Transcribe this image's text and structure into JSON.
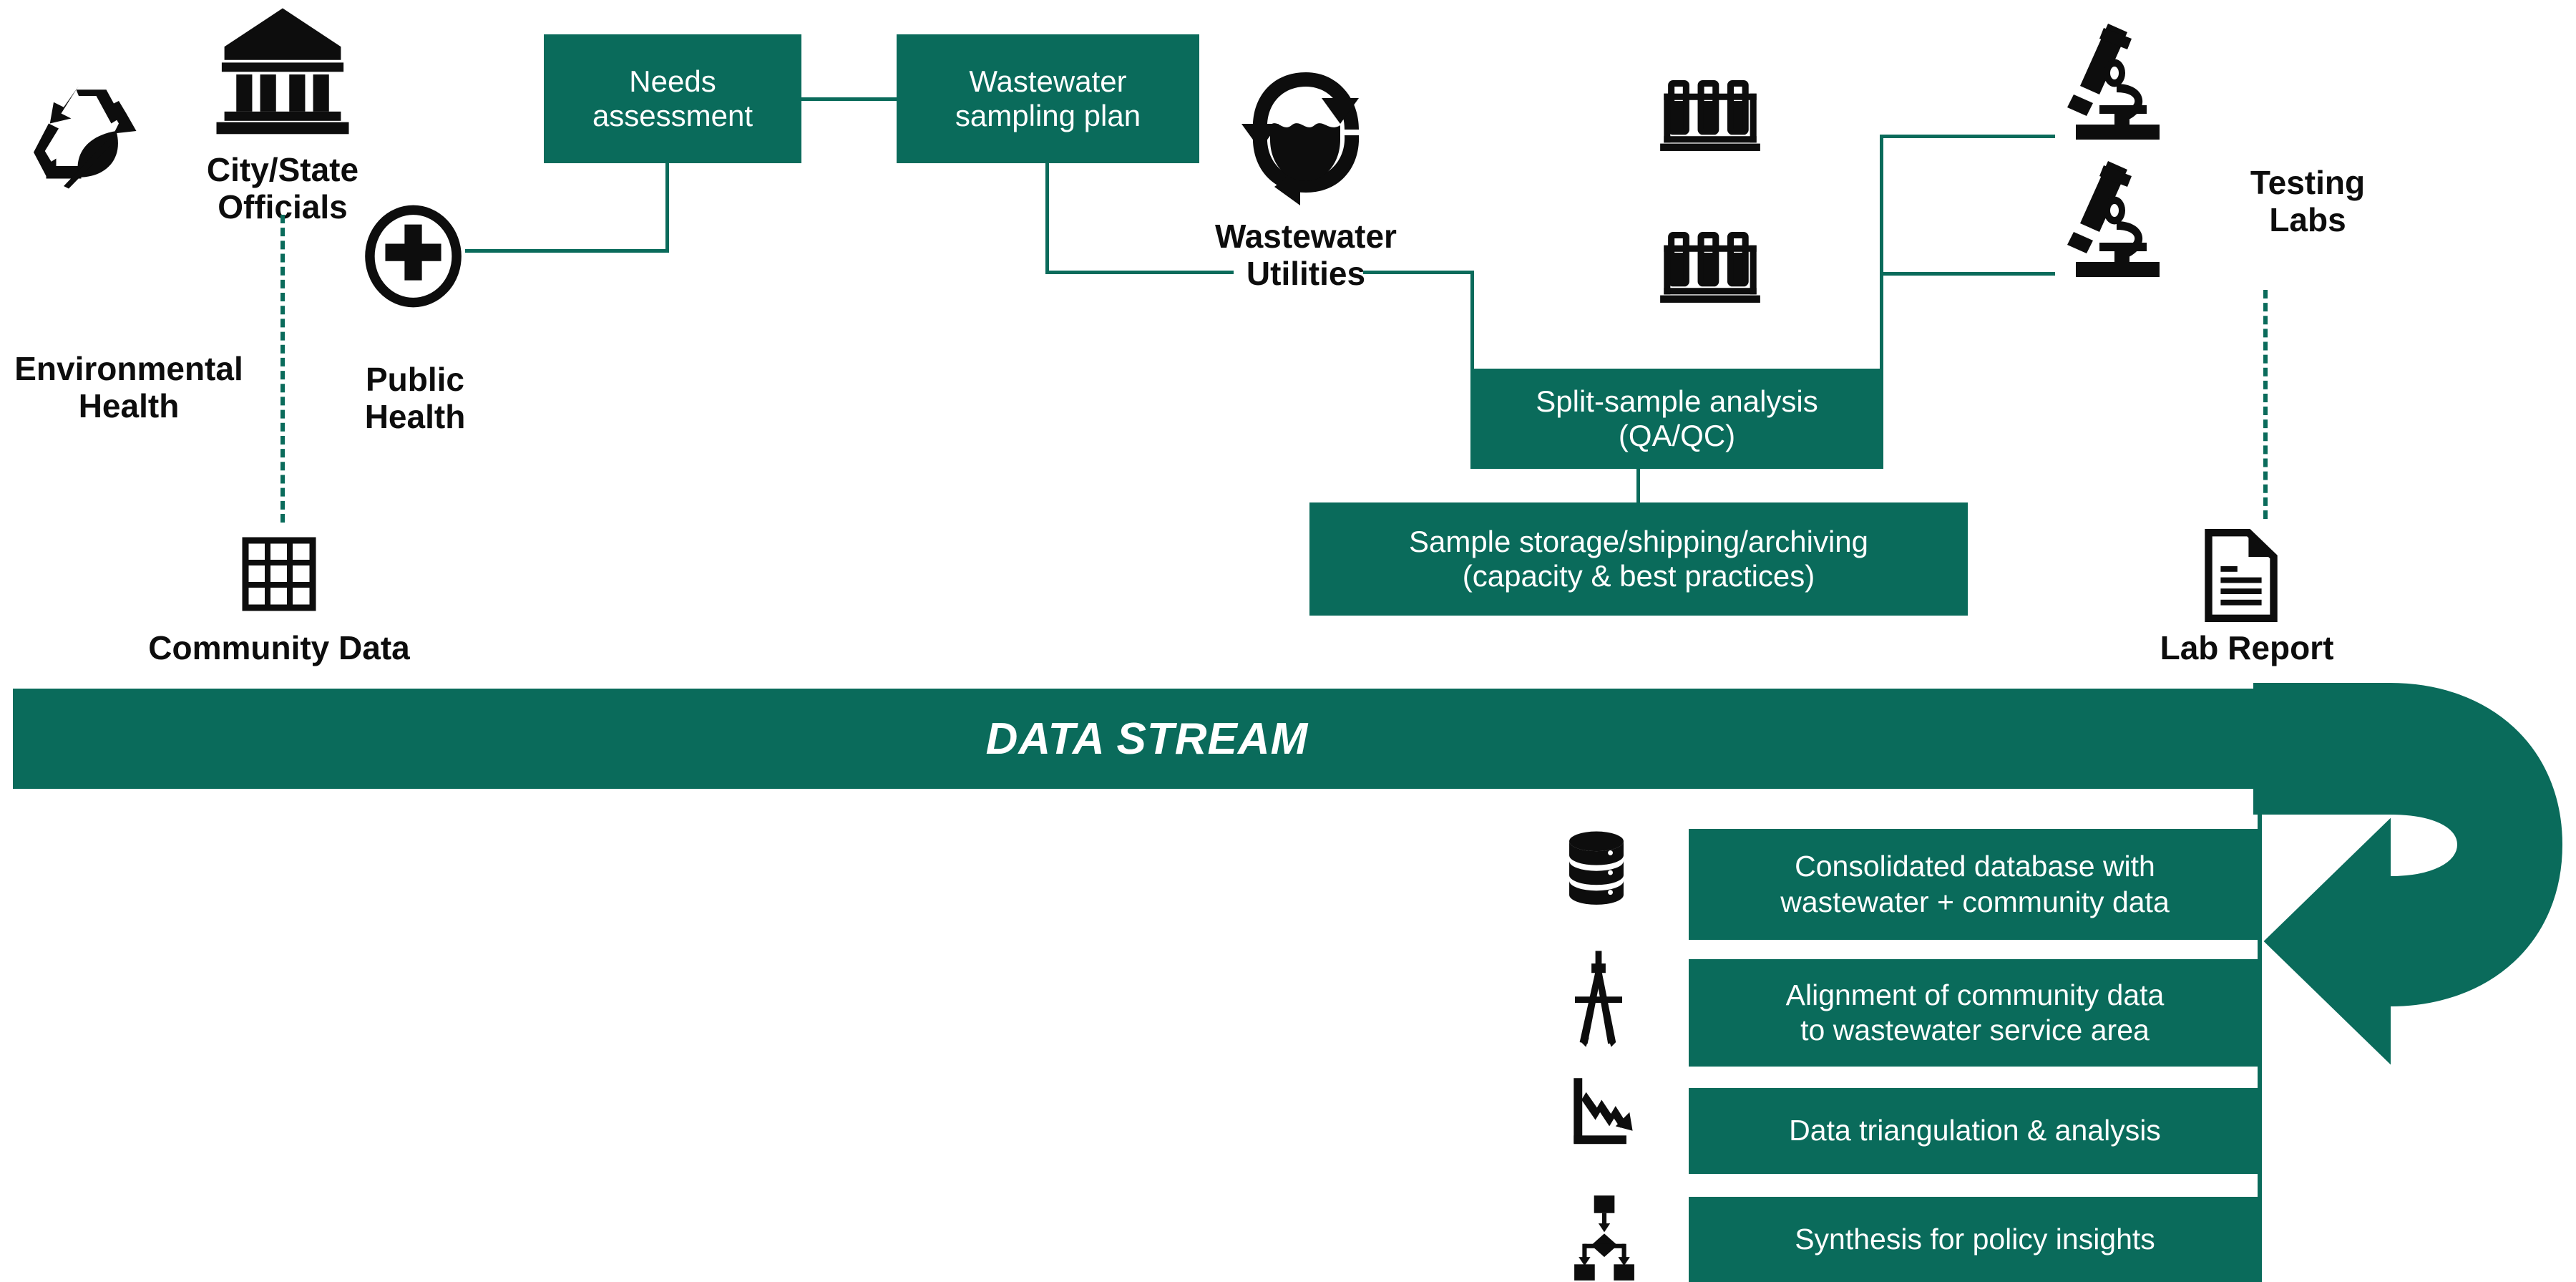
{
  "theme": {
    "green": "#0a6b5b",
    "ink": "#0d0d0d",
    "paper": "#ffffff"
  },
  "banner": {
    "label": "DATA STREAM"
  },
  "actors": [
    {
      "id": "city-state-officials",
      "icon": "bank-icon",
      "label": "City/State\nOfficials"
    },
    {
      "id": "environmental-health",
      "icon": "recycle-leaf-icon",
      "label": "Environmental\nHealth"
    },
    {
      "id": "public-health",
      "icon": "medical-cross-icon",
      "label": "Public\nHealth"
    },
    {
      "id": "community-data",
      "icon": "grid-table-icon",
      "label": "Community Data"
    },
    {
      "id": "wastewater-utilities",
      "icon": "water-cycle-icon",
      "label": "Wastewater\nUtilities"
    },
    {
      "id": "testing-labs",
      "icon": "microscope-icon",
      "label": "Testing\nLabs"
    },
    {
      "id": "lab-report",
      "icon": "document-icon",
      "label": "Lab Report"
    }
  ],
  "process_boxes": [
    {
      "id": "needs-assessment",
      "label": "Needs\nassessment"
    },
    {
      "id": "wastewater-sampling-plan",
      "label": "Wastewater\nsampling plan"
    },
    {
      "id": "split-sample-analysis",
      "label": "Split-sample analysis\n(QA/QC)"
    },
    {
      "id": "sample-storage",
      "label": "Sample storage/shipping/archiving\n(capacity & best practices)"
    }
  ],
  "sample_racks": [
    {
      "id": "test-tube-rack-1",
      "icon": "test-tube-rack-icon"
    },
    {
      "id": "test-tube-rack-2",
      "icon": "test-tube-rack-icon"
    }
  ],
  "microscopes": [
    {
      "id": "microscope-1",
      "icon": "microscope-icon"
    },
    {
      "id": "microscope-2",
      "icon": "microscope-icon"
    }
  ],
  "data_steps": [
    {
      "id": "consolidated-database",
      "icon": "database-icon",
      "label": "Consolidated database with\nwastewater + community  data"
    },
    {
      "id": "alignment-community",
      "icon": "compass-icon",
      "label": "Alignment of community  data\nto wastewater service area"
    },
    {
      "id": "data-triangulation",
      "icon": "chart-down-icon",
      "label": "Data triangulation & analysis"
    },
    {
      "id": "synthesis-policy",
      "icon": "hierarchy-icon",
      "label": "Synthesis for policy insights"
    }
  ]
}
